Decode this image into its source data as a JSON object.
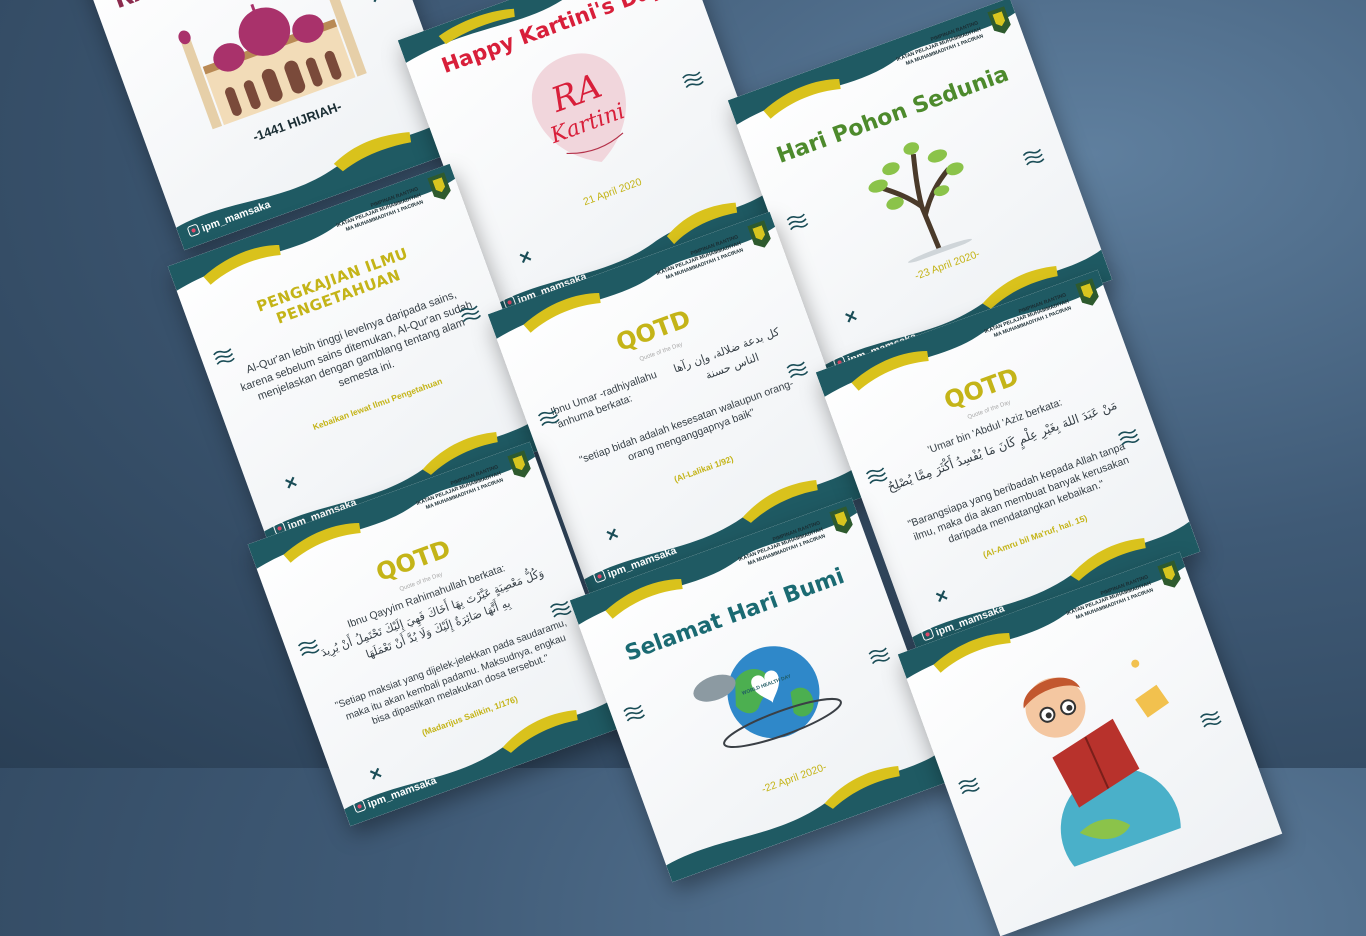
{
  "handle": "ipm_mamsaka",
  "org_lines": [
    "Pimpinan Ranting",
    "Ikatan Pelajar Muhammadiyah",
    "MA Muhammadiyah 1 Paciran"
  ],
  "colors": {
    "teal": "#1f5a63",
    "yellow": "#d9c21c",
    "card": "#f1f3f5",
    "background": "#3f5a76",
    "red": "#d81f3a",
    "green": "#4d8a2c"
  },
  "cards": [
    {
      "id": "hijriah",
      "title": "RA",
      "date": "-1441 HIJRIAH-",
      "illustration": "mosque-icon"
    },
    {
      "id": "kartini",
      "title": "Happy Kartini's Day",
      "date": "21 April 2020",
      "illustration": "kartini-portrait"
    },
    {
      "id": "hari-pohon",
      "title": "Hari Pohon Sedunia",
      "date": "-23 April 2020-",
      "illustration": "tree-icon"
    },
    {
      "id": "pengkajian",
      "title": "PENGKAJIAN ILMU PENGETAHUAN",
      "body": "Al-Qur'an lebih tinggi levelnya daripada sains, karena sebelum sains ditemukan, Al-Qur'an sudah menjelaskan dengan gamblang tentang alam semesta ini.",
      "source": "Kebaikan lewat Ilmu Pengetahuan"
    },
    {
      "id": "qotd-umar",
      "title": "QOTD",
      "subtitle": "Quote of the Day",
      "speaker": "Ibnu Umar -radhiyallahu 'anhuma berkata:",
      "arabic": "كل بدعة ضلالة، وإن رآها الناس حسنة",
      "quote": "\"setiap bidah adalah kesesatan walaupun orang-orang menganggapnya baik\"",
      "source": "(Al-Lalikai 1/92)"
    },
    {
      "id": "qotd-abdul-aziz",
      "title": "QOTD",
      "subtitle": "Quote of the Day",
      "speaker": "'Umar bin 'Abdul 'Aziz berkata:",
      "arabic": "مَنْ عَبَدَ اللهَ بِغَيْرِ عِلْمٍ كَانَ مَا يُفْسِدُ أَكْثَرَ مِمَّا يُصْلِحُ",
      "quote": "\"Barangsiapa yang beribadah kepada Allah tanpa ilmu, maka dia akan membuat banyak kerusakan daripada mendatangkan kebaikan.\"",
      "source": "(Al-Amru bil Ma'ruf, hal. 15)"
    },
    {
      "id": "qotd-qayyim",
      "title": "QOTD",
      "subtitle": "Quote of the Day",
      "speaker": "Ibnu Qayyim Rahimahullah berkata:",
      "arabic": "وَكُلُّ مَعْصِيَةٍ عَيَّرْتَ بِهَا أَخَاكَ فَهِيَ إِلَيْكَ تَحْتَمِلُ أَنْ يُرِيدَ بِهِ أَنَّهَا صَائِرَةٌ إِلَيْكَ وَلَا بُدَّ أَنْ تَعْمَلَهَا",
      "quote": "\"Setiap maksiat yang dijelek-jelekkan pada saudaramu, maka itu akan kembali padamu. Maksudnya, engkau bisa dipastikan melakukan dosa tersebut.\"",
      "source": "(Madarijus Salikin, 1/176)"
    },
    {
      "id": "hari-bumi",
      "title": "Selamat Hari Bumi",
      "globe_label": "WORLD HEALTH DAY",
      "date": "-22 April 2020-",
      "illustration": "earth-icon"
    },
    {
      "id": "reading",
      "illustration": "reading-boy-icon"
    }
  ]
}
